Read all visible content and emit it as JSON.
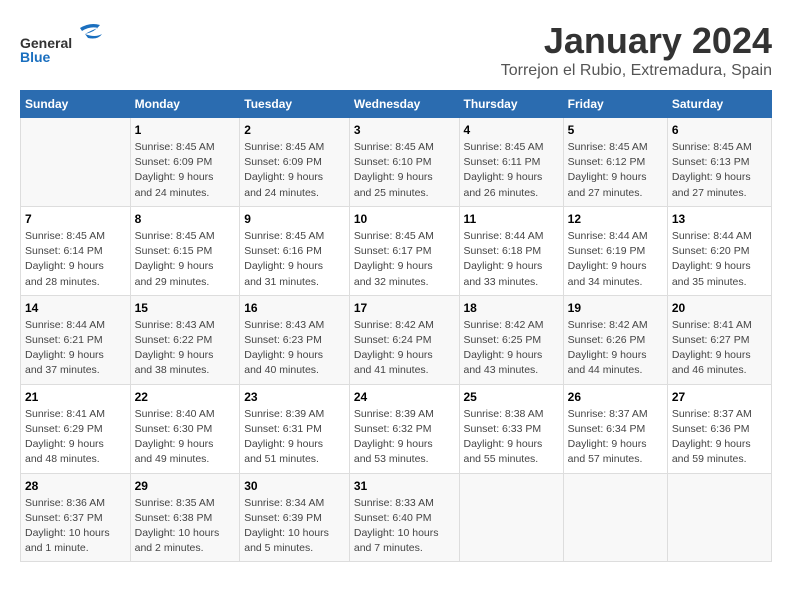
{
  "logo": {
    "part1": "General",
    "part2": "Blue"
  },
  "title": "January 2024",
  "subtitle": "Torrejon el Rubio, Extremadura, Spain",
  "header_days": [
    "Sunday",
    "Monday",
    "Tuesday",
    "Wednesday",
    "Thursday",
    "Friday",
    "Saturday"
  ],
  "weeks": [
    [
      {
        "day": "",
        "info": ""
      },
      {
        "day": "1",
        "info": "Sunrise: 8:45 AM\nSunset: 6:09 PM\nDaylight: 9 hours\nand 24 minutes."
      },
      {
        "day": "2",
        "info": "Sunrise: 8:45 AM\nSunset: 6:09 PM\nDaylight: 9 hours\nand 24 minutes."
      },
      {
        "day": "3",
        "info": "Sunrise: 8:45 AM\nSunset: 6:10 PM\nDaylight: 9 hours\nand 25 minutes."
      },
      {
        "day": "4",
        "info": "Sunrise: 8:45 AM\nSunset: 6:11 PM\nDaylight: 9 hours\nand 26 minutes."
      },
      {
        "day": "5",
        "info": "Sunrise: 8:45 AM\nSunset: 6:12 PM\nDaylight: 9 hours\nand 27 minutes."
      },
      {
        "day": "6",
        "info": "Sunrise: 8:45 AM\nSunset: 6:13 PM\nDaylight: 9 hours\nand 27 minutes."
      }
    ],
    [
      {
        "day": "7",
        "info": "Sunrise: 8:45 AM\nSunset: 6:14 PM\nDaylight: 9 hours\nand 28 minutes."
      },
      {
        "day": "8",
        "info": "Sunrise: 8:45 AM\nSunset: 6:15 PM\nDaylight: 9 hours\nand 29 minutes."
      },
      {
        "day": "9",
        "info": "Sunrise: 8:45 AM\nSunset: 6:16 PM\nDaylight: 9 hours\nand 31 minutes."
      },
      {
        "day": "10",
        "info": "Sunrise: 8:45 AM\nSunset: 6:17 PM\nDaylight: 9 hours\nand 32 minutes."
      },
      {
        "day": "11",
        "info": "Sunrise: 8:44 AM\nSunset: 6:18 PM\nDaylight: 9 hours\nand 33 minutes."
      },
      {
        "day": "12",
        "info": "Sunrise: 8:44 AM\nSunset: 6:19 PM\nDaylight: 9 hours\nand 34 minutes."
      },
      {
        "day": "13",
        "info": "Sunrise: 8:44 AM\nSunset: 6:20 PM\nDaylight: 9 hours\nand 35 minutes."
      }
    ],
    [
      {
        "day": "14",
        "info": "Sunrise: 8:44 AM\nSunset: 6:21 PM\nDaylight: 9 hours\nand 37 minutes."
      },
      {
        "day": "15",
        "info": "Sunrise: 8:43 AM\nSunset: 6:22 PM\nDaylight: 9 hours\nand 38 minutes."
      },
      {
        "day": "16",
        "info": "Sunrise: 8:43 AM\nSunset: 6:23 PM\nDaylight: 9 hours\nand 40 minutes."
      },
      {
        "day": "17",
        "info": "Sunrise: 8:42 AM\nSunset: 6:24 PM\nDaylight: 9 hours\nand 41 minutes."
      },
      {
        "day": "18",
        "info": "Sunrise: 8:42 AM\nSunset: 6:25 PM\nDaylight: 9 hours\nand 43 minutes."
      },
      {
        "day": "19",
        "info": "Sunrise: 8:42 AM\nSunset: 6:26 PM\nDaylight: 9 hours\nand 44 minutes."
      },
      {
        "day": "20",
        "info": "Sunrise: 8:41 AM\nSunset: 6:27 PM\nDaylight: 9 hours\nand 46 minutes."
      }
    ],
    [
      {
        "day": "21",
        "info": "Sunrise: 8:41 AM\nSunset: 6:29 PM\nDaylight: 9 hours\nand 48 minutes."
      },
      {
        "day": "22",
        "info": "Sunrise: 8:40 AM\nSunset: 6:30 PM\nDaylight: 9 hours\nand 49 minutes."
      },
      {
        "day": "23",
        "info": "Sunrise: 8:39 AM\nSunset: 6:31 PM\nDaylight: 9 hours\nand 51 minutes."
      },
      {
        "day": "24",
        "info": "Sunrise: 8:39 AM\nSunset: 6:32 PM\nDaylight: 9 hours\nand 53 minutes."
      },
      {
        "day": "25",
        "info": "Sunrise: 8:38 AM\nSunset: 6:33 PM\nDaylight: 9 hours\nand 55 minutes."
      },
      {
        "day": "26",
        "info": "Sunrise: 8:37 AM\nSunset: 6:34 PM\nDaylight: 9 hours\nand 57 minutes."
      },
      {
        "day": "27",
        "info": "Sunrise: 8:37 AM\nSunset: 6:36 PM\nDaylight: 9 hours\nand 59 minutes."
      }
    ],
    [
      {
        "day": "28",
        "info": "Sunrise: 8:36 AM\nSunset: 6:37 PM\nDaylight: 10 hours\nand 1 minute."
      },
      {
        "day": "29",
        "info": "Sunrise: 8:35 AM\nSunset: 6:38 PM\nDaylight: 10 hours\nand 2 minutes."
      },
      {
        "day": "30",
        "info": "Sunrise: 8:34 AM\nSunset: 6:39 PM\nDaylight: 10 hours\nand 5 minutes."
      },
      {
        "day": "31",
        "info": "Sunrise: 8:33 AM\nSunset: 6:40 PM\nDaylight: 10 hours\nand 7 minutes."
      },
      {
        "day": "",
        "info": ""
      },
      {
        "day": "",
        "info": ""
      },
      {
        "day": "",
        "info": ""
      }
    ]
  ]
}
